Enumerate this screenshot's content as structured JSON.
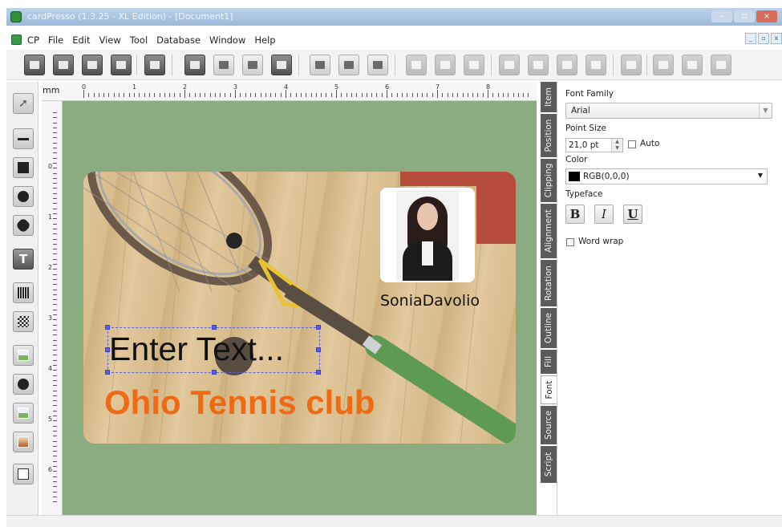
{
  "window": {
    "title": "cardPresso (1.3.25 - XL Edition) - [Document1]"
  },
  "menu": {
    "items": [
      "CP",
      "File",
      "Edit",
      "View",
      "Tool",
      "Database",
      "Window",
      "Help"
    ],
    "mdi_buttons": [
      "_",
      "▫",
      "x"
    ]
  },
  "toolbar": {
    "buttons": [
      "new-card",
      "open-card",
      "save-card",
      "print-preview",
      "print",
      "card-front",
      "card-back",
      "database",
      "encode",
      "zoom-in",
      "zoom-out",
      "zoom-fit",
      "align-1",
      "align-2",
      "align-3",
      "order-back",
      "order-backward",
      "order-forward",
      "order-front",
      "undo",
      "add",
      "remove",
      "check"
    ]
  },
  "tools": [
    "select",
    "line",
    "rectangle",
    "ellipse",
    "badge",
    "text",
    "barcode",
    "qrcode",
    "image",
    "camera",
    "background",
    "photo",
    "signature"
  ],
  "ruler": {
    "unit": "mm",
    "top_labels": [
      "0",
      "1",
      "2",
      "3",
      "4",
      "5",
      "6",
      "7",
      "8"
    ],
    "left_labels": [
      "0",
      "1",
      "2",
      "3",
      "4",
      "5",
      "6"
    ]
  },
  "card": {
    "name_text": "SoniaDavolio",
    "enter_text": "Enter Text...",
    "club_text": "Ohio Tennis club",
    "club_color": "#ef6a14",
    "background_color": "#8aac80"
  },
  "tabs": [
    "Item",
    "Position",
    "Clipping",
    "Alignment",
    "Rotation",
    "Outline",
    "Fill",
    "Font",
    "Source",
    "Script"
  ],
  "active_tab": "Font",
  "font_panel": {
    "font_family_label": "Font Family",
    "font_family_value": "Arial",
    "point_size_label": "Point Size",
    "point_size_value": "21,0 pt",
    "auto_label": "Auto",
    "color_label": "Color",
    "color_value": "RGB(0,0,0)",
    "typeface_label": "Typeface",
    "bold": "B",
    "italic": "I",
    "underline": "U",
    "word_wrap_label": "Word wrap"
  }
}
